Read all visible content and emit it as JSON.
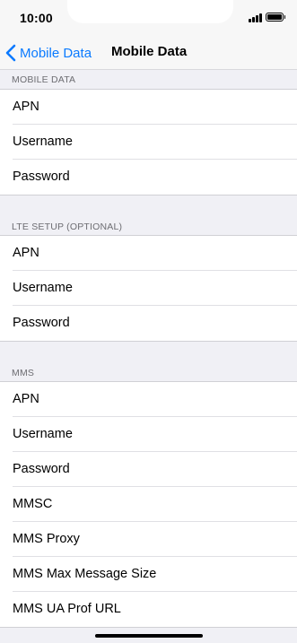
{
  "status": {
    "time": "10:00"
  },
  "nav": {
    "back_label": "Mobile Data",
    "title": "Mobile Data"
  },
  "sections": [
    {
      "header": "MOBILE DATA",
      "rows": [
        "APN",
        "Username",
        "Password"
      ]
    },
    {
      "header": "LTE SETUP (OPTIONAL)",
      "rows": [
        "APN",
        "Username",
        "Password"
      ]
    },
    {
      "header": "MMS",
      "rows": [
        "APN",
        "Username",
        "Password",
        "MMSC",
        "MMS Proxy",
        "MMS Max Message Size",
        "MMS UA Prof URL"
      ]
    }
  ],
  "colors": {
    "accent": "#0a7aff",
    "background": "#f0f0f5",
    "header_text": "#6d6d72"
  },
  "icons": {
    "back": "chevron-left-icon",
    "signal": "signal-bars-icon",
    "battery": "battery-icon"
  }
}
